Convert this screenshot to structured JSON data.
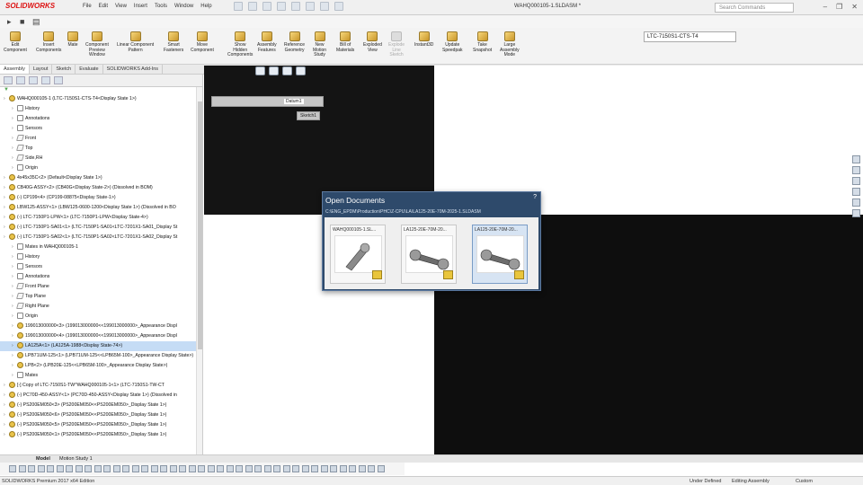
{
  "app": {
    "logo": "SOLIDWORKS",
    "document_title": "WAHQ000105-1.SLDASM *",
    "search_placeholder": "Search Commands"
  },
  "menus": [
    "File",
    "Edit",
    "View",
    "Insert",
    "Tools",
    "Window",
    "Help"
  ],
  "ribbon": [
    {
      "label": "Edit\nComponent",
      "enabled": true
    },
    {
      "label": "Insert\nComponents",
      "enabled": true
    },
    {
      "label": "Mate",
      "enabled": true
    },
    {
      "label": "Component\nPreview\nWindow",
      "enabled": true
    },
    {
      "label": "Linear Component\nPattern",
      "enabled": true
    },
    {
      "label": "Smart\nFasteners",
      "enabled": true
    },
    {
      "label": "Move\nComponent",
      "enabled": true
    },
    {
      "label": "Show\nHidden\nComponents",
      "enabled": true
    },
    {
      "label": "Assembly\nFeatures",
      "enabled": true
    },
    {
      "label": "Reference\nGeometry",
      "enabled": true
    },
    {
      "label": "New\nMotion\nStudy",
      "enabled": true
    },
    {
      "label": "Bill of\nMaterials",
      "enabled": true
    },
    {
      "label": "Exploded\nView",
      "enabled": true
    },
    {
      "label": "Explode\nLine\nSketch",
      "enabled": false
    },
    {
      "label": "Instant3D",
      "enabled": true
    },
    {
      "label": "Update\nSpeedpak",
      "enabled": true
    },
    {
      "label": "Take\nSnapshot",
      "enabled": true
    },
    {
      "label": "Large\nAssembly\nMode",
      "enabled": true
    }
  ],
  "configuration": "LTC-7150S1-CTS-T4",
  "command_tabs": [
    "Assembly",
    "Layout",
    "Sketch",
    "Evaluate",
    "SOLIDWORKS Add-Ins"
  ],
  "tree": [
    {
      "text": "WAHQ000105-1 (LTC-7150S1-CTS-T4<Display State 1>)",
      "level": 0,
      "icon": "asm"
    },
    {
      "text": "History",
      "level": 1,
      "icon": "doc"
    },
    {
      "text": "Annotations",
      "level": 1,
      "icon": "doc"
    },
    {
      "text": "Sensors",
      "level": 1,
      "icon": "doc"
    },
    {
      "text": "Front",
      "level": 1,
      "icon": "plane"
    },
    {
      "text": "Top",
      "level": 1,
      "icon": "plane"
    },
    {
      "text": "Side,RH",
      "level": 1,
      "icon": "plane"
    },
    {
      "text": "Origin",
      "level": 1,
      "icon": "doc"
    },
    {
      "text": "4x45x35C<2> (Default<Display State 1>)",
      "level": 0,
      "icon": "asm"
    },
    {
      "text": "CB40G-ASSY<2> (CB40G<Display State-2>) (Dissolved in BOM)",
      "level": 0,
      "icon": "asm"
    },
    {
      "text": "(-) CP199<4> (CP199-08875<Display State-1>)",
      "level": 0,
      "icon": "asm"
    },
    {
      "text": "LBW125-ASSY<1> (LBW125-0600-1200<Display State 1>) (Dissolved in BO",
      "level": 0,
      "icon": "asm"
    },
    {
      "text": "(-) LTC-7150P1-LPW<1> (LTC-7150P1-LPW<Display State-4>)",
      "level": 0,
      "icon": "asm"
    },
    {
      "text": "(-) LTC-7150P1-SA01<1> (LTC-7150P1-SA01<LTC-7201X1-SA01_Display St",
      "level": 0,
      "icon": "asm"
    },
    {
      "text": "(-) LTC-7150P1-SA02<1> (LTC-7150P1-SA02<LTC-7201X1-SA02_Display St",
      "level": 0,
      "icon": "asm"
    },
    {
      "text": "Mates in WAHQ000105-1",
      "level": 1,
      "icon": "doc"
    },
    {
      "text": "History",
      "level": 1,
      "icon": "doc"
    },
    {
      "text": "Sensors",
      "level": 1,
      "icon": "doc"
    },
    {
      "text": "Annotations",
      "level": 1,
      "icon": "doc"
    },
    {
      "text": "Front Plane",
      "level": 1,
      "icon": "plane"
    },
    {
      "text": "Top Plane",
      "level": 1,
      "icon": "plane"
    },
    {
      "text": "Right Plane",
      "level": 1,
      "icon": "plane"
    },
    {
      "text": "Origin",
      "level": 1,
      "icon": "doc"
    },
    {
      "text": "199013000000<3> (199013000000<<199013000000>_Appearance Displ",
      "level": 1,
      "icon": "asm"
    },
    {
      "text": "199013000000<4> (199013000000<<199013000000>_Appearance Displ",
      "level": 1,
      "icon": "asm"
    },
    {
      "text": "LA125A<1> (LA125A-1988<Display State-74>)",
      "level": 1,
      "icon": "asm",
      "selected": true
    },
    {
      "text": "LPB71UM-125<1> (LPB71UM-125<<LPB65M-100>_Appearance Display State>)",
      "level": 1,
      "icon": "asm"
    },
    {
      "text": "LPB<2> (LPB20E-125<<LPB65M-100>_Appearance Display State>)",
      "level": 1,
      "icon": "asm"
    },
    {
      "text": "Mates",
      "level": 1,
      "icon": "doc"
    },
    {
      "text": "[-] Copy of LTC-7150S1-TW^WAHQ000105-1<1> (LTC-7150S1-TW-CT",
      "level": 0,
      "icon": "asm"
    },
    {
      "text": "(-) PC70D-450-ASSY<1> (PC70D-450-ASSY<Display State 1>) (Dissolved in",
      "level": 0,
      "icon": "asm"
    },
    {
      "text": "(-) PS200EM050<3> (PS200EM050<<PS200EM050>_Display State 1>)",
      "level": 0,
      "icon": "asm"
    },
    {
      "text": "(-) PS200EM050<6> (PS200EM050<<PS200EM050>_Display State 1>)",
      "level": 0,
      "icon": "asm"
    },
    {
      "text": "(-) PS200EM050<5> (PS200EM050<<PS200EM050>_Display State 1>)",
      "level": 0,
      "icon": "asm"
    },
    {
      "text": "(-) PS200EM050<1> (PS200EM050<<PS200EM050>_Display State 1>)",
      "level": 0,
      "icon": "asm"
    }
  ],
  "viewport": {
    "mini_label": "Datum1",
    "sketch_label": "Sketch1"
  },
  "dialog": {
    "title": "Open Documents",
    "help": "?",
    "path": "C:\\ENG_EPDM\\Production\\PHC\\Z-CPU\\LA\\LA125-20E-70M-2025-1.SLDASM",
    "documents": [
      {
        "name": "WAHQ000105-1.SL...",
        "selected": false
      },
      {
        "name": "LA125-20E-70M-20...",
        "selected": false
      },
      {
        "name": "LA125-20E-70M-20...",
        "selected": true
      }
    ]
  },
  "bottom_tabs": [
    "Model",
    "Motion Study 1"
  ],
  "status": {
    "edition": "SOLIDWORKS Premium 2017 x64 Edition",
    "state": "Under Defined",
    "mode": "Editing Assembly",
    "units": "Custom"
  }
}
